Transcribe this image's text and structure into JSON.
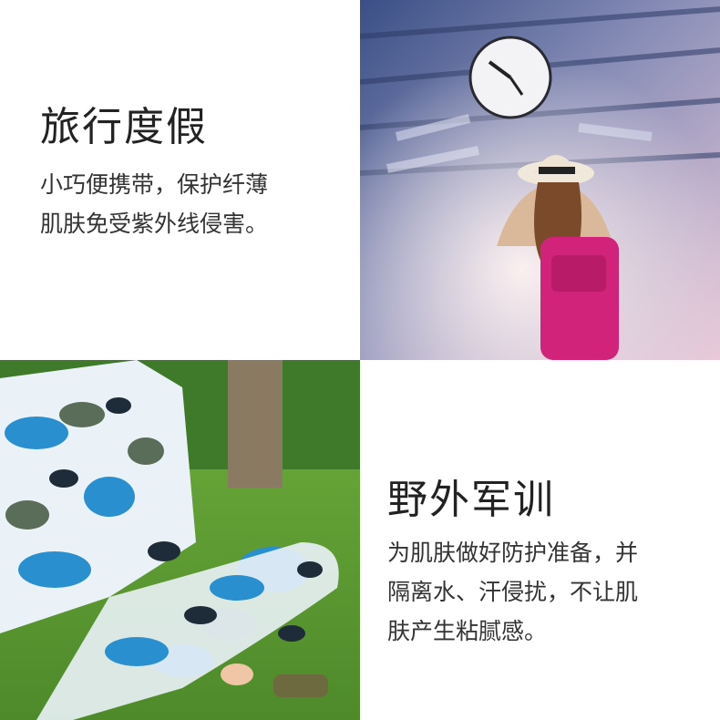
{
  "panels": {
    "travel": {
      "title": "旅行度假",
      "lines": [
        "小巧便携带，保护纤薄",
        "肌肤免受紫外线侵害。"
      ],
      "image_icon": "train-station-photo-icon"
    },
    "military": {
      "title": "野外军训",
      "lines": [
        "为肌肤做好防护准备，并",
        "隔离水、汗侵扰，不让肌",
        "肤产生粘腻感。"
      ],
      "image_icon": "camouflage-photo-icon"
    }
  },
  "colors": {
    "text_title": "#222222",
    "text_body": "#333333",
    "background": "#ffffff",
    "backpack": "#d2237a"
  }
}
